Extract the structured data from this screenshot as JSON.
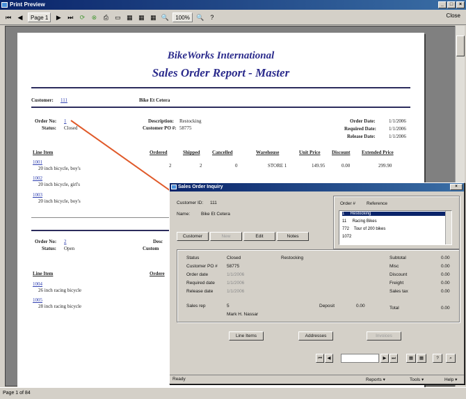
{
  "window": {
    "title": "Print Preview",
    "close_label": "Close"
  },
  "toolbar": {
    "page_label": "Page 1",
    "zoom": "100%",
    "help": "?"
  },
  "report": {
    "title1": "BikeWorks International",
    "title2": "Sales Order Report - Master",
    "customer_label": "Customer:",
    "customer_id": "111",
    "customer_name": "Bike Et Cetera",
    "order1": {
      "order_no_label": "Order No:",
      "order_no": "1",
      "status_label": "Status:",
      "status": "Closed",
      "description_label": "Description:",
      "description": "Restocking",
      "customer_po_label": "Customer PO #:",
      "customer_po": "58775",
      "order_date_label": "Order Date:",
      "order_date": "1/1/2006",
      "required_date_label": "Required Date:",
      "required_date": "1/1/2006",
      "release_date_label": "Release Date:",
      "release_date": "1/1/2006"
    },
    "line_headers": [
      "Line Item",
      "Ordered",
      "Shipped",
      "Cancelled",
      "Warehouse",
      "Unit Price",
      "Discount",
      "Extended Price"
    ],
    "line_row": {
      "ordered": "2",
      "shipped": "2",
      "cancelled": "0",
      "warehouse": "STORE 1",
      "unit_price": "149.95",
      "discount": "0.00",
      "extended": "299.90"
    },
    "items1": [
      {
        "code": "1001",
        "desc": "20 inch bicycle, boy's"
      },
      {
        "code": "1002",
        "desc": "20 inch bicycle, girl's"
      },
      {
        "code": "1003",
        "desc": "20 inch bicycle, boy's"
      }
    ],
    "order2": {
      "order_no_label": "Order No:",
      "order_no": "2",
      "status_label": "Status:",
      "status": "Open",
      "description_label_trunc": "Desc",
      "customer_po_label_trunc": "Custom",
      "ordered_trunc": "Ordere"
    },
    "items2": [
      {
        "code": "1004",
        "desc": "26 inch racing bicycle"
      },
      {
        "code": "1005",
        "desc": "28 inch racing bicycle"
      }
    ],
    "line_item_header2": "Line Item"
  },
  "dialog": {
    "title": "Sales Order Inquiry",
    "customer_id_label": "Customer ID:",
    "customer_id": "111",
    "name_label": "Name:",
    "name": "Bike Et Cetera",
    "buttons": {
      "customer": "Customer",
      "new": "New",
      "edit": "Edit",
      "notes": "Notes"
    },
    "order_list_headers": [
      "Order #",
      "Reference"
    ],
    "orders": [
      {
        "num": "1",
        "ref": "Restocking"
      },
      {
        "num": "11",
        "ref": "Racing Bikes"
      },
      {
        "num": "772",
        "ref": "Tour of 200 bikes"
      },
      {
        "num": "1072",
        "ref": ""
      }
    ],
    "status_label": "Status",
    "status_value": "Closed",
    "status_desc": "Restocking",
    "customer_po_label": "Customer PO #",
    "customer_po": "58775",
    "order_date_label": "Order date",
    "order_date": "1/1/2006",
    "required_date_label": "Required date",
    "required_date": "1/1/2006",
    "release_date_label": "Release date",
    "release_date": "1/1/2006",
    "sales_rep_label": "Sales rep",
    "sales_rep": "5",
    "sales_rep_name": "Mark H. Nassar",
    "deposit_label": "Deposit",
    "deposit": "0.00",
    "totals": [
      {
        "label": "Subtotal",
        "value": "0.00"
      },
      {
        "label": "Misc",
        "value": "0.00"
      },
      {
        "label": "Discount",
        "value": "0.00"
      },
      {
        "label": "Freight",
        "value": "0.00"
      },
      {
        "label": "Sales tax",
        "value": "0.00"
      },
      {
        "label": "Total",
        "value": "0.00"
      }
    ],
    "bottom_buttons": {
      "line_items": "Line Items",
      "addresses": "Addresses",
      "third": "Invoices"
    },
    "status_text": "Ready",
    "menus": {
      "m1": "Reports",
      "m2": "Tools",
      "m3": "Help"
    }
  },
  "statusbar": {
    "text": "Page 1 of 84"
  },
  "colors": {
    "title_blue": "#2b2b8c",
    "link_blue": "#3040b0",
    "arrow": "#e05a2a"
  }
}
